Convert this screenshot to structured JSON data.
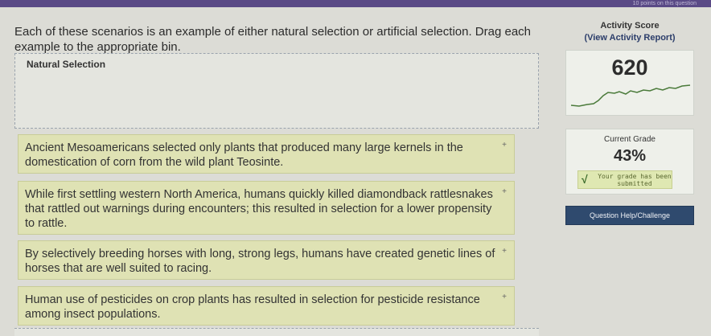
{
  "header": {
    "note": "10 points on this question"
  },
  "prompt": "Each of these scenarios is an example of either natural selection or artificial selection. Drag each example to the appropriate bin.",
  "bins": [
    {
      "label": "Natural Selection"
    }
  ],
  "cards": [
    {
      "text": "Ancient Mesoamericans selected only plants that produced many large kernels in the domestication of corn from the wild plant Teosinte.",
      "icon": "plus-icon",
      "icon_glyph": "+"
    },
    {
      "text": "While first settling western North America, humans quickly killed diamondback rattlesnakes that rattled out warnings during encounters; this resulted in selection for a lower propensity to rattle.",
      "icon": "plus-icon",
      "icon_glyph": "+"
    },
    {
      "text": "By selectively breeding horses with long, strong legs, humans have created genetic lines of horses that are well suited to racing.",
      "icon": "plus-icon",
      "icon_glyph": "+"
    },
    {
      "text": "Human use of pesticides on crop plants has resulted in selection for pesticide resistance among insect populations.",
      "icon": "plus-icon",
      "icon_glyph": "+"
    }
  ],
  "sidebar": {
    "activity_score_title": "Activity Score",
    "activity_report_link": "(View Activity Report)",
    "activity_score": "620",
    "current_grade_title": "Current Grade",
    "current_grade": "43%",
    "submitted_text": "Your grade has been submitted",
    "check_glyph": "√",
    "help_button": "Question Help/Challenge"
  },
  "colors": {
    "card_bg": "#dfe2b4",
    "bin_border": "#9aa3ad",
    "graph_line": "#4a7a3a",
    "help_button_bg": "#2f4a6e"
  }
}
